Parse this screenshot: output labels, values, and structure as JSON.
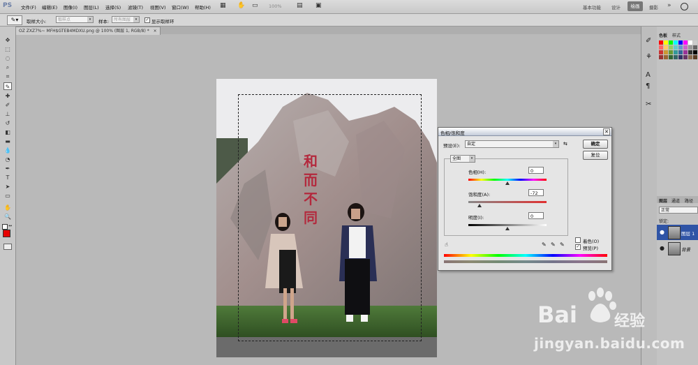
{
  "app": {
    "logo": "PS"
  },
  "menu": [
    "文件(F)",
    "编辑(E)",
    "图像(I)",
    "图层(L)",
    "选择(S)",
    "滤镜(T)",
    "视图(V)",
    "窗口(W)",
    "帮助(H)"
  ],
  "menubar": {
    "zoom": "100%",
    "icons": [
      "layout-icon",
      "hand-icon",
      "zoom-icon",
      "rotate-icon",
      "arrange-icon",
      "screen-mode-icon"
    ]
  },
  "workspaces": {
    "items": [
      "基本功能",
      "设计",
      "绘画",
      "摄影"
    ],
    "active": "绘画",
    "more": "»"
  },
  "options": {
    "sample_size_label": "取样大小:",
    "sample_size_value": "取样点",
    "sample_label": "样本:",
    "sample_value": "所有图层",
    "show_ring_label": "显示取样环"
  },
  "document": {
    "tab_title": "OZ ZXZ7%~ MFH$GTEB4MDXU.png @ 100% (图层 1, RGB/8) *",
    "close": "×"
  },
  "toolbar": {
    "tools": [
      "move",
      "marquee",
      "lasso",
      "quick-select",
      "crop",
      "eyedropper",
      "healing",
      "brush",
      "clone-stamp",
      "history-brush",
      "eraser",
      "gradient",
      "blur",
      "dodge",
      "pen",
      "type",
      "path-select",
      "shape",
      "hand",
      "zoom"
    ],
    "active_tool": "eyedropper",
    "foreground_color": "#e60000",
    "background_color": "#ffffff"
  },
  "photo": {
    "rock_text": [
      "和",
      "而",
      "不",
      "同"
    ],
    "rock_text_color": "#b3293d"
  },
  "dialog": {
    "title": "色相/饱和度",
    "close": "✕",
    "preset_label": "预设(E):",
    "preset_value": "自定",
    "ok": "确定",
    "reset": "复位",
    "channel": "全图",
    "hue_label": "色相(H):",
    "hue_value": "0",
    "saturation_label": "饱和度(A):",
    "saturation_value": "-72",
    "lightness_label": "明度(I):",
    "lightness_value": "0",
    "colorize_label": "着色(O)",
    "colorize_checked": false,
    "preview_label": "预览(P)",
    "preview_checked": true
  },
  "right_panel": {
    "top_tabs": [
      "色板",
      "样式"
    ],
    "layer_tabs": [
      "图层",
      "通道",
      "路径"
    ],
    "blend_mode": "正常",
    "lock_label": "锁定:",
    "layers": [
      {
        "name": "图层 1",
        "selected": true
      },
      {
        "name": "背景",
        "selected": false
      }
    ]
  },
  "watermark": {
    "text": "jingyan.baidu.com",
    "logo_text": "Bai",
    "logo_text2": "经验"
  }
}
